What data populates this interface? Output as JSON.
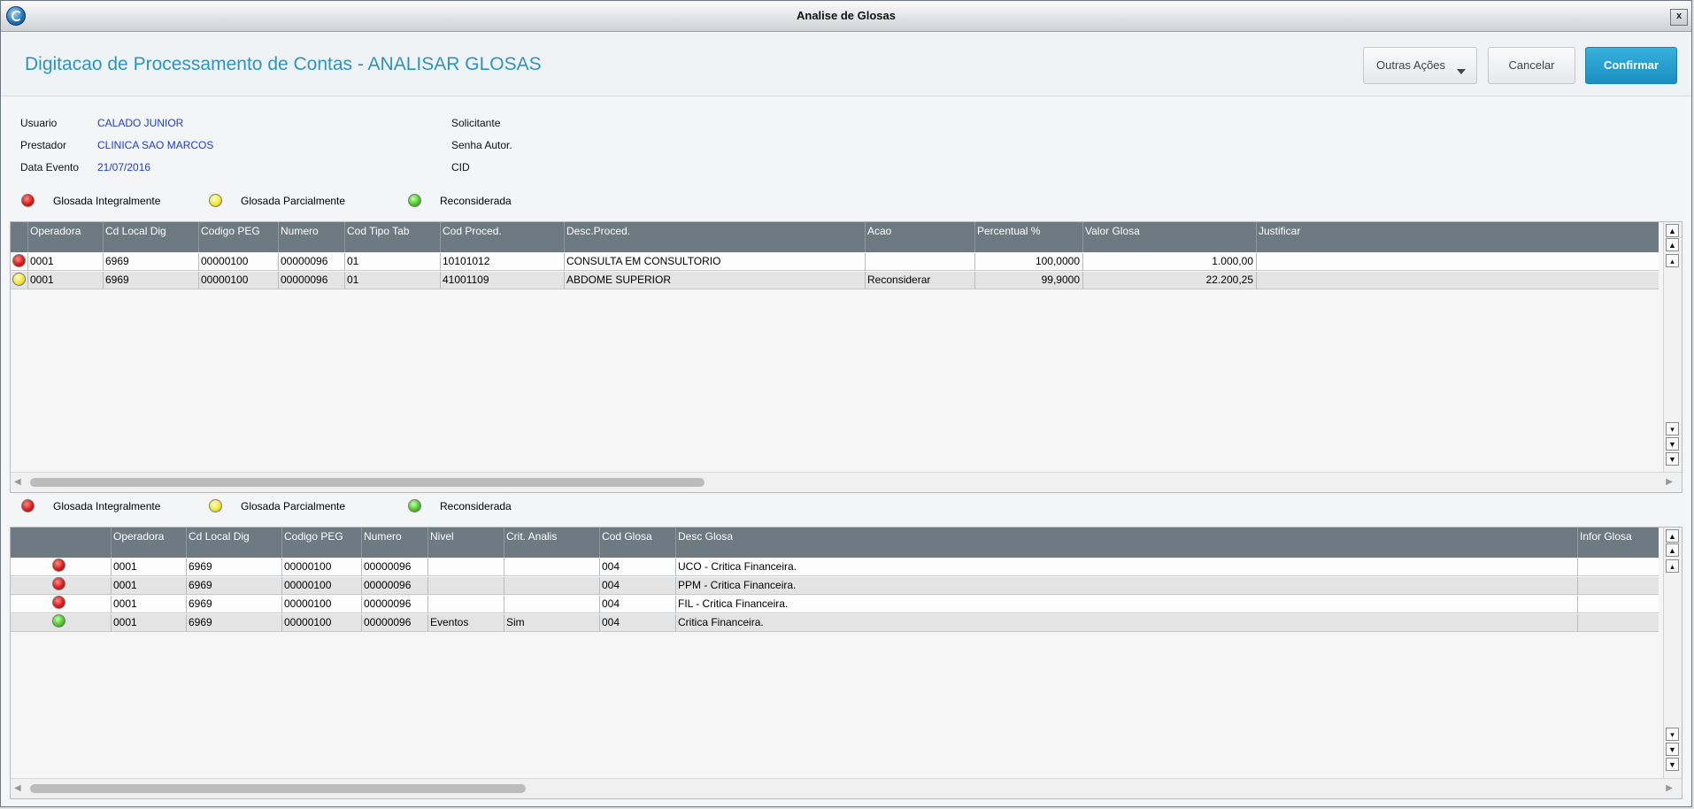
{
  "window": {
    "title": "Analise de Glosas",
    "close_label": "x"
  },
  "header": {
    "title": "Digitacao de Processamento de Contas - ANALISAR GLOSAS",
    "buttons": {
      "outras": "Outras Ações",
      "cancelar": "Cancelar",
      "confirmar": "Confirmar"
    }
  },
  "info": {
    "usuario_label": "Usuario",
    "usuario_value": "CALADO JUNIOR",
    "prestador_label": "Prestador",
    "prestador_value": "CLINICA SAO MARCOS",
    "data_label": "Data Evento",
    "data_value": "21/07/2016",
    "solicitante_label": "Solicitante",
    "senha_label": "Senha Autor.",
    "cid_label": "CID"
  },
  "legend": {
    "red": "Glosada Integralmente",
    "yellow": "Glosada Parcialmente",
    "green": "Reconsiderada"
  },
  "grid1": {
    "headers": [
      "Operadora",
      "Cd Local Dig",
      "Codigo PEG",
      "Numero",
      "Cod Tipo Tab",
      "Cod Proced.",
      "Desc.Proced.",
      "Acao",
      "Percentual %",
      "Valor Glosa",
      "Justificar"
    ],
    "rows": [
      {
        "status": "red",
        "cells": [
          "0001",
          "6969",
          "00000100",
          "00000096",
          "01",
          "10101012",
          "CONSULTA EM CONSULTORIO",
          "",
          "100,0000",
          "1.000,00",
          ""
        ]
      },
      {
        "status": "yellow",
        "cells": [
          "0001",
          "6969",
          "00000100",
          "00000096",
          "01",
          "41001109",
          "ABDOME SUPERIOR",
          "Reconsiderar",
          "99,9000",
          "22.200,25",
          ""
        ]
      }
    ]
  },
  "grid2": {
    "headers": [
      "",
      "Operadora",
      "Cd Local Dig",
      "Codigo PEG",
      "Numero",
      "Nivel",
      "Crit. Analis",
      "Cod Glosa",
      "Desc Glosa",
      "Infor Glosa"
    ],
    "rows": [
      {
        "status": "red",
        "cells": [
          "",
          "0001",
          "6969",
          "00000100",
          "00000096",
          "",
          "",
          "004",
          "UCO - Critica Financeira.",
          ""
        ]
      },
      {
        "status": "red",
        "cells": [
          "",
          "0001",
          "6969",
          "00000100",
          "00000096",
          "",
          "",
          "004",
          "PPM - Critica Financeira.",
          ""
        ]
      },
      {
        "status": "red",
        "cells": [
          "",
          "0001",
          "6969",
          "00000100",
          "00000096",
          "",
          "",
          "004",
          "FIL - Critica Financeira.",
          ""
        ]
      },
      {
        "status": "green",
        "cells": [
          "",
          "0001",
          "6969",
          "00000100",
          "00000096",
          "Eventos",
          "Sim",
          "004",
          "Critica Financeira.",
          ""
        ]
      }
    ]
  }
}
